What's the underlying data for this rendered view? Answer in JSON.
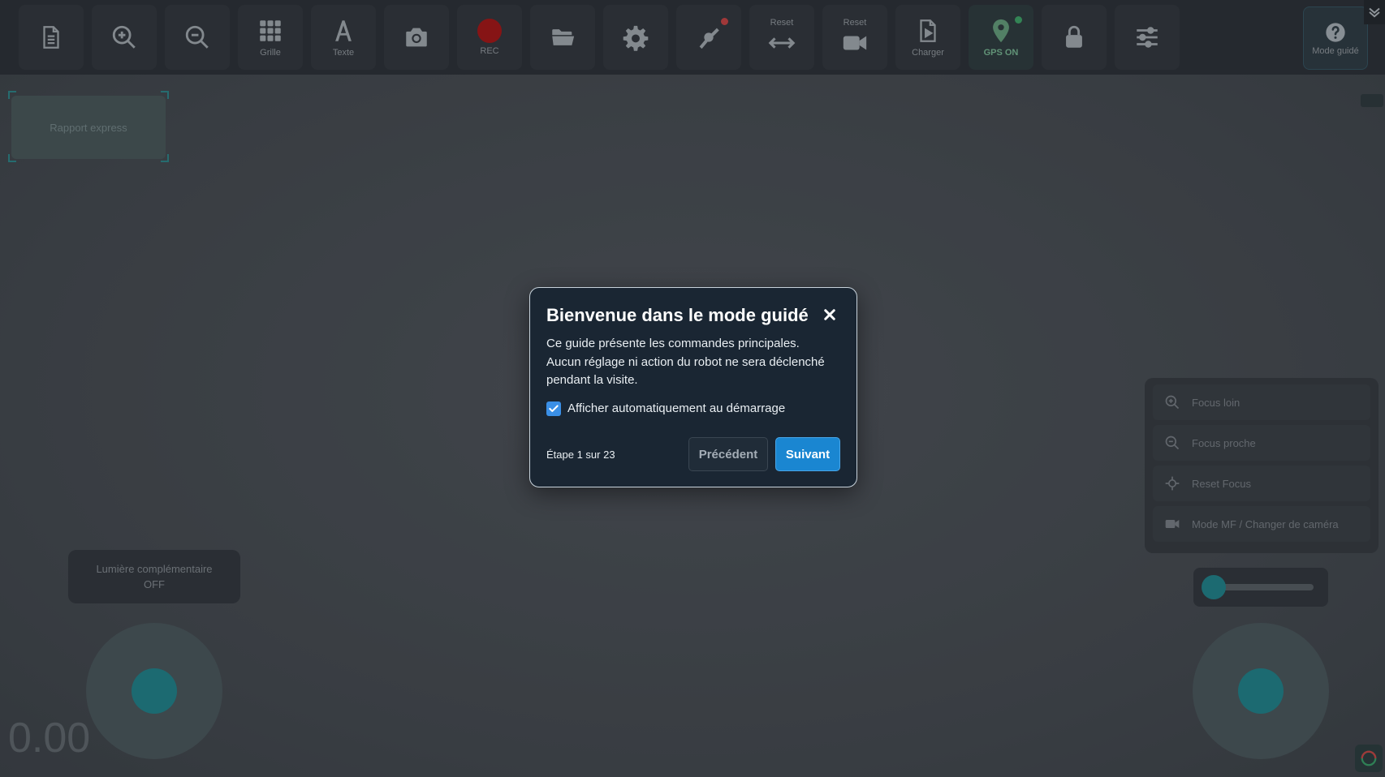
{
  "toolbar": {
    "buttons": [
      {
        "id": "report",
        "icon": "document-icon",
        "label": ""
      },
      {
        "id": "zoom-in",
        "icon": "zoom-in-icon",
        "label": ""
      },
      {
        "id": "zoom-out",
        "icon": "zoom-out-icon",
        "label": ""
      },
      {
        "id": "grid",
        "icon": "grid-icon",
        "label": "Grille"
      },
      {
        "id": "text",
        "icon": "text-icon",
        "label": "Texte"
      },
      {
        "id": "photo",
        "icon": "camera-icon",
        "label": ""
      },
      {
        "id": "rec",
        "icon": "record-icon",
        "label": "REC"
      },
      {
        "id": "folder",
        "icon": "folder-icon",
        "label": ""
      },
      {
        "id": "settings",
        "icon": "gear-icon",
        "label": ""
      },
      {
        "id": "robot",
        "icon": "robot-arm-icon",
        "label": ""
      },
      {
        "id": "reset-h",
        "icon": "horizontal-arrows-icon",
        "top_label": "Reset"
      },
      {
        "id": "reset-cam",
        "icon": "video-camera-icon",
        "top_label": "Reset"
      },
      {
        "id": "load",
        "icon": "load-file-icon",
        "label": "Charger"
      },
      {
        "id": "gps",
        "icon": "location-pin-icon",
        "label": "GPS ON"
      },
      {
        "id": "lock",
        "icon": "lock-icon",
        "label": ""
      },
      {
        "id": "sliders",
        "icon": "sliders-icon",
        "label": ""
      }
    ],
    "help_label": "Mode guidé"
  },
  "overlay_label": "Rapport express",
  "light_button": {
    "line1": "Lumière complémentaire",
    "line2": "OFF"
  },
  "speed": {
    "value": "0.00"
  },
  "focus_panel": {
    "items": [
      {
        "label": "Focus loin",
        "icon": "zoom-in-icon"
      },
      {
        "label": "Focus proche",
        "icon": "zoom-out-icon"
      },
      {
        "label": "Reset Focus",
        "icon": "crosshair-icon"
      },
      {
        "label": "Mode MF / Changer de caméra",
        "icon": "video-camera-icon"
      }
    ]
  },
  "modal": {
    "title": "Bienvenue dans le mode guidé",
    "body_line1": "Ce guide présente les commandes principales.",
    "body_line2": "Aucun réglage ni action du robot ne sera déclenché pendant la visite.",
    "checkbox_label": "Afficher automatiquement au démarrage",
    "checkbox_checked": true,
    "step_text": "Étape 1 sur 23",
    "prev_label": "Précédent",
    "next_label": "Suivant"
  },
  "colors": {
    "accent": "#1a86d1",
    "modal_bg": "#1a2633",
    "rec": "#b21212",
    "teal": "#1f8a92"
  }
}
